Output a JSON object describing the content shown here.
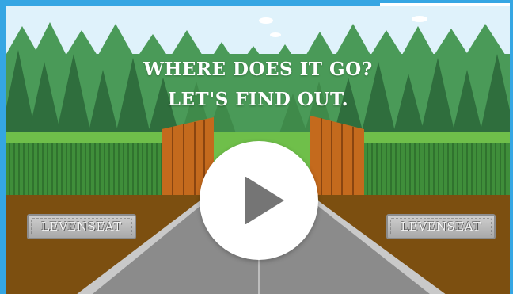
{
  "video": {
    "headline_line1": "WHERE DOES IT GO?",
    "headline_line2": "LET'S FIND OUT.",
    "sign_left": "LEVENSEAT",
    "sign_right": "LEVENSEAT",
    "play_icon": "play-icon"
  },
  "colors": {
    "frame_border": "#35a6e3",
    "sky": "#dff2fb",
    "forest_dark": "#2f6e3d",
    "forest_mid": "#3f8a4a",
    "grass": "#6fbf4a",
    "soil": "#7c4f10",
    "road": "#8b8b8b",
    "gate": "#c46a1d",
    "play_button": "#ffffff",
    "play_icon": "#757575"
  }
}
